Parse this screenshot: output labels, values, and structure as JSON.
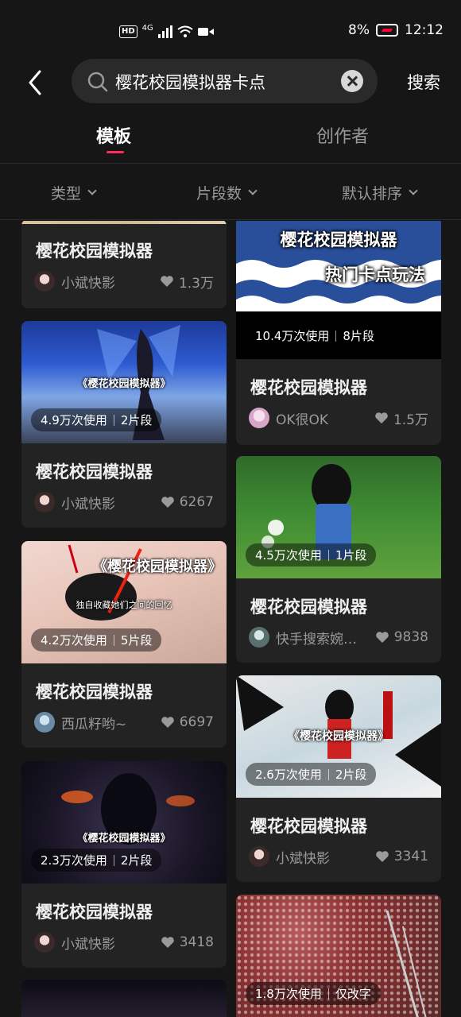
{
  "status": {
    "network": "4G",
    "time": "12:12",
    "battery": "8%",
    "hd": "HD"
  },
  "search": {
    "query": "樱花校园模拟器卡点",
    "button": "搜索"
  },
  "tabs": [
    {
      "label": "模板",
      "active": true
    },
    {
      "label": "创作者",
      "active": false
    }
  ],
  "filters": [
    {
      "label": "类型"
    },
    {
      "label": "片段数"
    },
    {
      "label": "默认排序"
    }
  ],
  "colors": {
    "accent": "#ff2d55",
    "background": "#161616",
    "card": "#232323"
  },
  "left": [
    {
      "title": "樱花校园模拟器",
      "author": "小斌快影",
      "likes": "1.3万"
    },
    {
      "usage": "4.9万次使用",
      "segments": "2片段",
      "overlay": "《樱花校园模拟器》",
      "title": "樱花校园模拟器",
      "author": "小斌快影",
      "likes": "6267"
    },
    {
      "usage": "4.2万次使用",
      "segments": "5片段",
      "overlay": "《樱花校园模拟器》",
      "subtext": "独自收藏她们之间的回忆",
      "title": "樱花校园模拟器",
      "author": "西瓜籽哟~",
      "likes": "6697"
    },
    {
      "usage": "2.3万次使用",
      "segments": "2片段",
      "overlay": "《樱花校园模拟器》",
      "title": "樱花校园模拟器",
      "author": "小斌快影",
      "likes": "3418"
    }
  ],
  "right": [
    {
      "overlay1": "樱花校园模拟器",
      "overlay2": "热门卡点玩法",
      "usage": "10.4万次使用",
      "segments": "8片段",
      "title": "樱花校园模拟器",
      "author": "OK很OK",
      "likes": "1.5万"
    },
    {
      "usage": "4.5万次使用",
      "segments": "1片段",
      "title": "樱花校园模拟器",
      "author": "快手搜索婉妤...",
      "likes": "9838"
    },
    {
      "usage": "2.6万次使用",
      "segments": "2片段",
      "overlay": "《樱花校园模拟器》",
      "title": "樱花校园模拟器",
      "author": "小斌快影",
      "likes": "3341"
    },
    {
      "usage": "1.8万次使用",
      "segments": "仅改字"
    }
  ]
}
